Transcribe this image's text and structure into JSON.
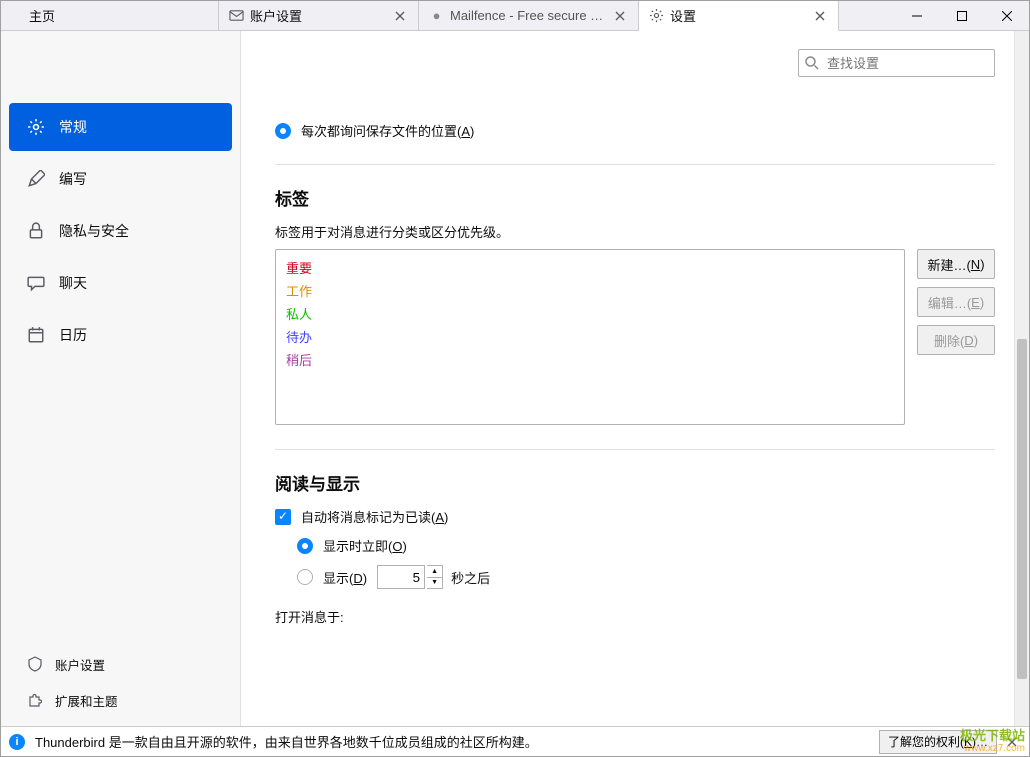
{
  "tabs": {
    "home": "主页",
    "accounts": "账户设置",
    "mailfence": "Mailfence - Free secure em",
    "settings": "设置"
  },
  "search": {
    "placeholder": "查找设置"
  },
  "sidebar": {
    "general": "常规",
    "compose": "编写",
    "privacy": "隐私与安全",
    "chat": "聊天",
    "calendar": "日历",
    "account": "账户设置",
    "addons": "扩展和主题"
  },
  "file_save_radio": "每次都询问保存文件的位置(A)",
  "tags": {
    "title": "标签",
    "desc": "标签用于对消息进行分类或区分优先级。",
    "items": [
      {
        "label": "重要",
        "color": "#d70022"
      },
      {
        "label": "工作",
        "color": "#e08b00"
      },
      {
        "label": "私人",
        "color": "#12bc00"
      },
      {
        "label": "待办",
        "color": "#4040ff"
      },
      {
        "label": "稍后",
        "color": "#a040a0"
      }
    ],
    "new_btn": "新建…(N)",
    "edit_btn": "编辑…(E)",
    "delete_btn": "删除(D)"
  },
  "reading": {
    "title": "阅读与显示",
    "mark_read": "自动将消息标记为已读(A)",
    "immediate": "显示时立即(O)",
    "after_delay_pre": "显示(D)",
    "after_delay_value": "5",
    "after_delay_post": "秒之后",
    "open_in": "打开消息于:"
  },
  "bottom": {
    "text": "Thunderbird 是一款自由且开源的软件，由来自世界各地数千位成员组成的社区所构建。",
    "rights_btn": "了解您的权利(K)…"
  },
  "watermark": {
    "line1": "极光下载站",
    "line2": "www.xz7.com"
  }
}
